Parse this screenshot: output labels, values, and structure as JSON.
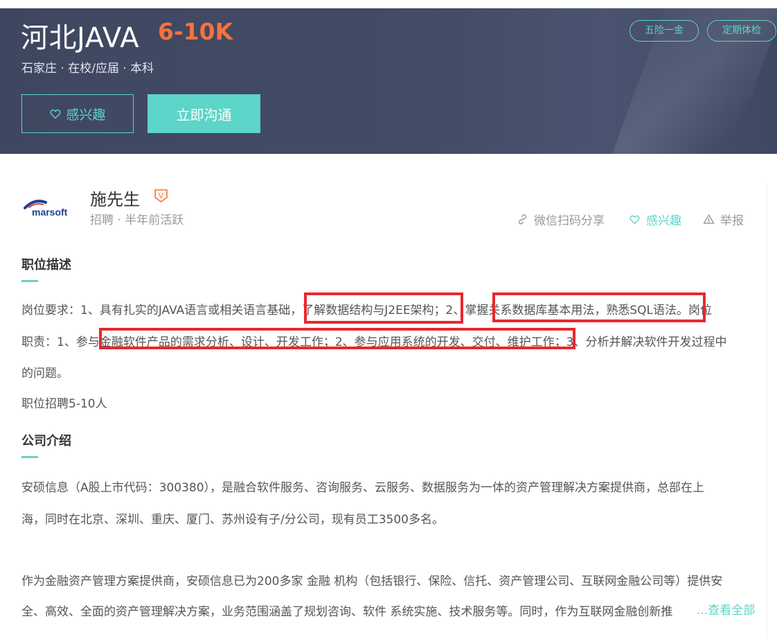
{
  "banner": {
    "title": "河北JAVA",
    "salary": "6-10K",
    "meta": "石家庄 · 在校/应届 · 本科",
    "tags": [
      "五险一金",
      "定期体检"
    ],
    "interest_label": "感兴趣",
    "chat_label": "立即沟通"
  },
  "recruiter": {
    "logo_text": "marsoft",
    "name": "施先生",
    "badge": "V",
    "status": "招聘 · 半年前活跃"
  },
  "actions": {
    "share": "微信扫码分享",
    "interest": "感兴趣",
    "report": "举报"
  },
  "job_description": {
    "title": "职位描述",
    "lines": [
      "岗位要求：1、具有扎实的JAVA语言或相关语言基础，了解数据结构与J2EE架构；2、掌握关系数据库基本用法，熟悉SQL语法。岗位",
      "职责：1、参与金融软件产品的需求分析、设计、开发工作；2、参与应用系统的开发、交付、维护工作；3、分析并解决软件开发过程中",
      "的问题。",
      "职位招聘5-10人"
    ]
  },
  "company": {
    "title": "公司介绍",
    "lines": [
      "安硕信息（A股上市代码：300380），是融合软件服务、咨询服务、云服务、数据服务为一体的资产管理解决方案提供商，总部在上",
      "海，同时在北京、深圳、重庆、厦门、苏州设有子/分公司，现有员工3500多名。",
      "作为金融资产管理方案提供商，安硕信息已为200多家 金融 机构（包括银行、保险、信托、资产管理公司、互联网金融公司等）提供安",
      "全、高效、全面的资产管理解决方案，业务范围涵盖了规划咨询、软件 系统实施、技术服务等。同时，作为互联网金融创新推"
    ],
    "see_all": "...查看全部"
  },
  "colors": {
    "banner_bg": "#434b66",
    "accent": "#5dd5c8",
    "salary": "#fc703e",
    "highlight_box": "#e8282d"
  }
}
